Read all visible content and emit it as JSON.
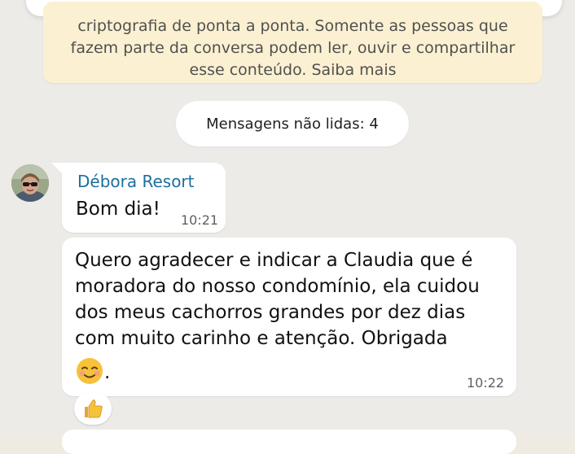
{
  "encryption_notice": {
    "lines": [
      "criptografia de ponta a ponta. Somente as pessoas que",
      "fazem parte da conversa podem ler, ouvir e compartilhar",
      "esse conteúdo. Saiba mais"
    ]
  },
  "unread_divider": {
    "label": "Mensagens não lidas: 4"
  },
  "messages": [
    {
      "sender": "Débora Resort",
      "text": "Bom dia!",
      "time": "10:21",
      "avatar_icon": "profile-photo-avatar"
    },
    {
      "lines": [
        "Quero agradecer e indicar a Claudia que é",
        "moradora do nosso condomínio, ela cuidou",
        "dos meus cachorros grandes por dez dias",
        "com muito carinho e atenção. Obrigada"
      ],
      "trailing_text": ".",
      "emoji_icon": "smiling-face-emoji",
      "time": "10:22",
      "reaction_icon": "thumbs-up-emoji"
    }
  ],
  "colors": {
    "chat_background": "#ecebe8",
    "notice_background": "#fbf0d1",
    "sender_name": "#1d6f9e",
    "bubble": "#ffffff"
  }
}
